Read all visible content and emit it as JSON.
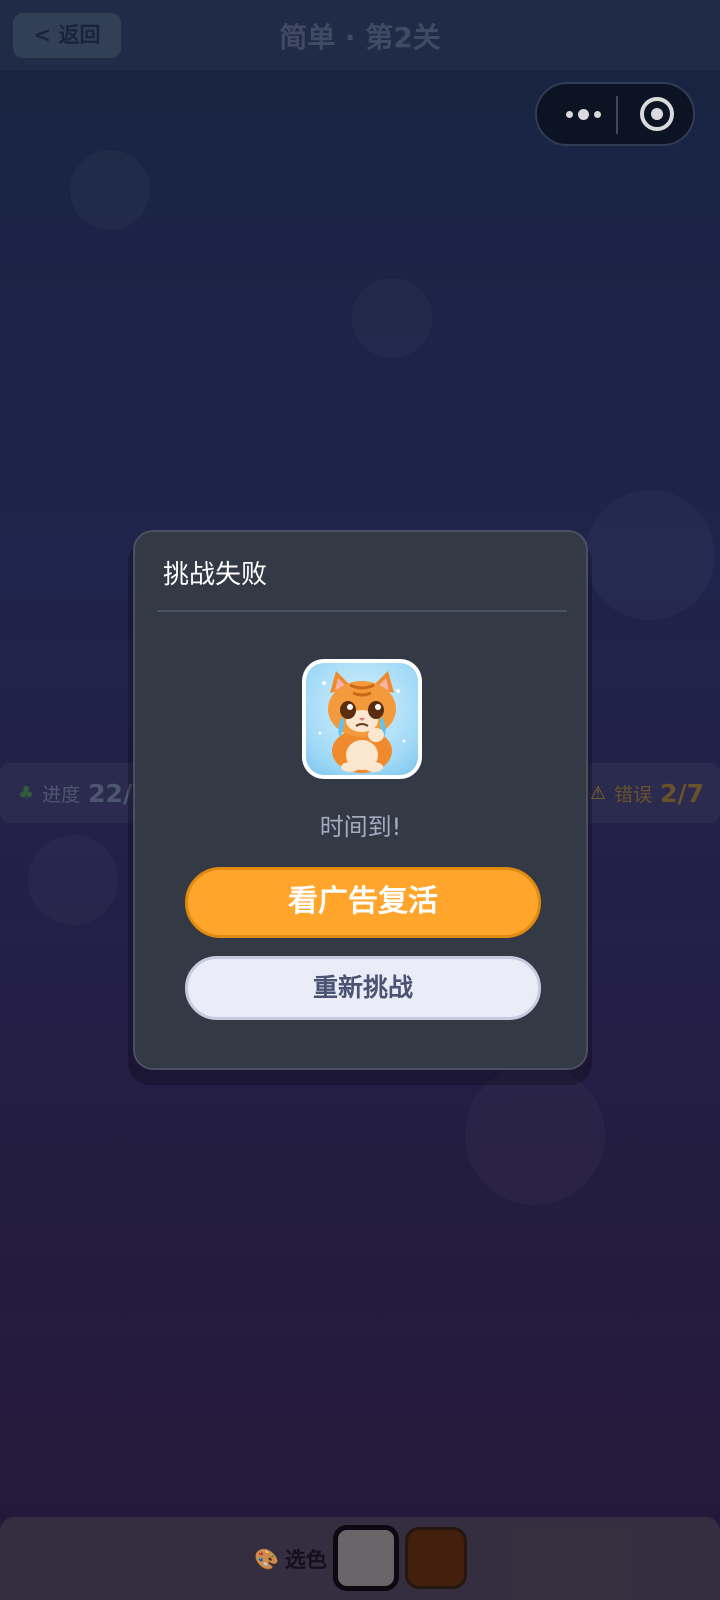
{
  "header": {
    "back_label": "< 返回",
    "title": "简单 · 第2关"
  },
  "capsule": {
    "more_icon": "more-dots-icon",
    "close_icon": "target-icon"
  },
  "stats": {
    "progress_icon": "leaf-icon",
    "progress_label": "进度",
    "progress_value": "22/",
    "error_icon": "warning-icon",
    "error_label": "错误",
    "error_value": "2/7"
  },
  "palette": {
    "icon": "palette-icon",
    "label": "选色",
    "swatches": [
      {
        "color": "#7a7678",
        "selected": true
      },
      {
        "color": "#4d250c",
        "selected": false
      }
    ]
  },
  "modal": {
    "title": "挑战失败",
    "image": "crying-cat-image",
    "message": "时间到!",
    "revive_label": "看广告复活",
    "retry_label": "重新挑战"
  },
  "colors": {
    "accent_orange": "#ffa52b",
    "modal_bg": "#343946",
    "secondary_button_bg": "#eaecf7"
  }
}
